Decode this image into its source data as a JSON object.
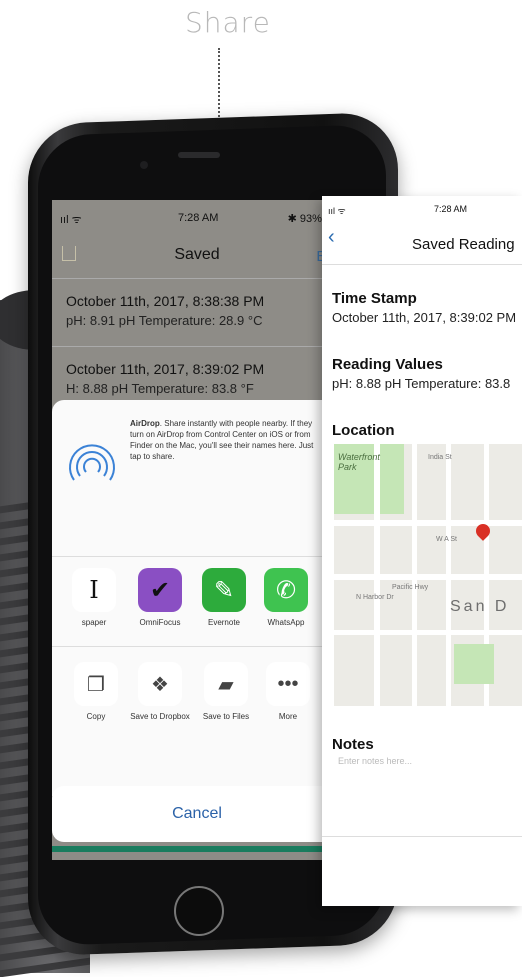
{
  "callout": {
    "label": "Share"
  },
  "phone": {
    "status": {
      "signal": "ııl ᯤ",
      "time": "7:28 AM",
      "battery": "✱ 93% ▬"
    },
    "nav": {
      "title": "Saved",
      "edit": "Edi"
    },
    "readings": [
      {
        "timestamp": "October 11th, 2017, 8:38:38 PM",
        "values": "pH: 8.91 pH  Temperature: 28.9 °C"
      },
      {
        "timestamp": "October 11th, 2017, 8:39:02 PM",
        "values": "H: 8.88 pH  Temperature: 83.8 °F"
      }
    ],
    "share_sheet": {
      "airdrop_bold": "AirDrop",
      "airdrop_text": ". Share instantly with people nearby. If they turn on AirDrop from Control Center on iOS or from Finder on the Mac, you'll see their names here. Just tap to share.",
      "apps": [
        {
          "label": "spaper",
          "icon": "newspaper-icon"
        },
        {
          "label": "OmniFocus",
          "icon": "omnifocus-icon"
        },
        {
          "label": "Evernote",
          "icon": "evernote-icon"
        },
        {
          "label": "WhatsApp",
          "icon": "whatsapp-icon"
        }
      ],
      "actions": [
        {
          "label": "Copy",
          "icon": "copy-icon"
        },
        {
          "label": "Save to Dropbox",
          "icon": "dropbox-icon"
        },
        {
          "label": "Save to Files",
          "icon": "folder-icon"
        },
        {
          "label": "More",
          "icon": "more-icon"
        }
      ],
      "cancel": "Cancel"
    }
  },
  "detail": {
    "status": {
      "signal": "ııl ᯤ",
      "time": "7:28 AM"
    },
    "title": "Saved Reading",
    "timestamp_heading": "Time Stamp",
    "timestamp_value": "October 11th, 2017, 8:39:02 PM",
    "values_heading": "Reading Values",
    "values_value": "pH: 8.88 pH  Temperature: 83.8",
    "location_heading": "Location",
    "map": {
      "park_label": "Waterfront Park",
      "streets": [
        "India St",
        "N Harbor Dr",
        "Pacific Hwy",
        "W A St"
      ],
      "city": "San D"
    },
    "notes_heading": "Notes",
    "notes_placeholder": "Enter notes here..."
  },
  "colors": {
    "accent": "#2b62a8",
    "dim_overlay": "#8e8c87",
    "map_pin": "#d93025",
    "callout": "#b8b8b8"
  }
}
